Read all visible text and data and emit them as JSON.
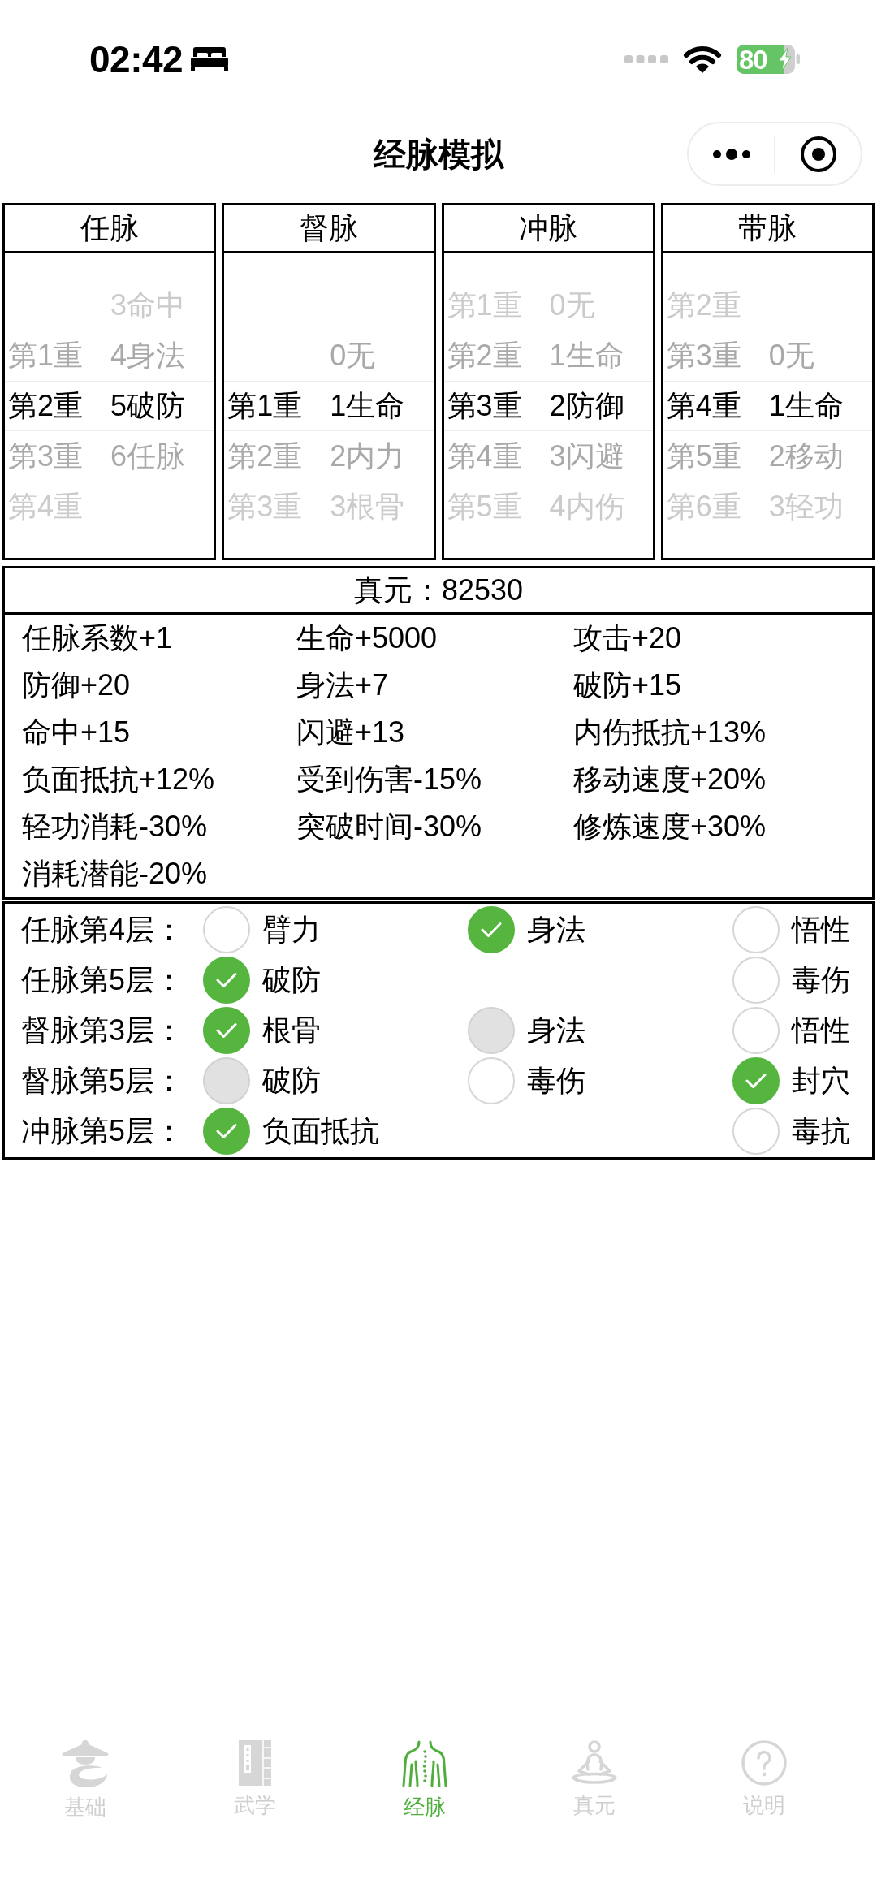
{
  "status_bar": {
    "time": "02:42",
    "battery": "80",
    "charging": true
  },
  "nav_bar": {
    "title": "经脉模拟"
  },
  "meridians": [
    {
      "title": "任脉",
      "levels": [
        {
          "label": "第1重",
          "selected": false
        },
        {
          "label": "第2重",
          "selected": true
        },
        {
          "label": "第3重",
          "selected": false
        },
        {
          "label": "第4重",
          "selected": false
        }
      ],
      "attributes": [
        {
          "label": "3命中",
          "selected": false
        },
        {
          "label": "4身法",
          "selected": false
        },
        {
          "label": "5破防",
          "selected": true
        },
        {
          "label": "6任脉",
          "selected": false
        }
      ]
    },
    {
      "title": "督脉",
      "levels": [
        {
          "label": "第1重",
          "selected": true
        },
        {
          "label": "第2重",
          "selected": false
        },
        {
          "label": "第3重",
          "selected": false
        }
      ],
      "attributes": [
        {
          "label": "0无",
          "selected": false
        },
        {
          "label": "1生命",
          "selected": true
        },
        {
          "label": "2内力",
          "selected": false
        },
        {
          "label": "3根骨",
          "selected": false
        }
      ]
    },
    {
      "title": "冲脉",
      "levels": [
        {
          "label": "第1重",
          "selected": false
        },
        {
          "label": "第2重",
          "selected": false
        },
        {
          "label": "第3重",
          "selected": true
        },
        {
          "label": "第4重",
          "selected": false
        },
        {
          "label": "第5重",
          "selected": false
        }
      ],
      "attributes": [
        {
          "label": "0无",
          "selected": false
        },
        {
          "label": "1生命",
          "selected": false
        },
        {
          "label": "2防御",
          "selected": true
        },
        {
          "label": "3闪避",
          "selected": false
        },
        {
          "label": "4内伤",
          "selected": false
        }
      ]
    },
    {
      "title": "带脉",
      "levels": [
        {
          "label": "第2重",
          "selected": false
        },
        {
          "label": "第3重",
          "selected": false
        },
        {
          "label": "第4重",
          "selected": true
        },
        {
          "label": "第5重",
          "selected": false
        },
        {
          "label": "第6重",
          "selected": false
        }
      ],
      "attributes": [
        {
          "label": "0无",
          "selected": false
        },
        {
          "label": "1生命",
          "selected": true
        },
        {
          "label": "2移动",
          "selected": false
        },
        {
          "label": "3轻功",
          "selected": false
        }
      ]
    }
  ],
  "stats": {
    "total": "真元：82530",
    "bonuses": [
      "任脉系数+1",
      "生命+5000",
      "攻击+20",
      "防御+20",
      "身法+7",
      "破防+15",
      "命中+15",
      "闪避+13",
      "内伤抵抗+13%",
      "负面抵抗+12%",
      "受到伤害-15%",
      "移动速度+20%",
      "轻功消耗-30%",
      "突破时间-30%",
      "修炼速度+30%",
      "消耗潜能-20%"
    ]
  },
  "choices": [
    {
      "label": "任脉第4层：",
      "left": {
        "label": "臂力",
        "checked": false,
        "disabled": false
      },
      "middle": {
        "label": "身法",
        "checked": true,
        "disabled": false
      },
      "right": {
        "label": "悟性",
        "checked": false,
        "disabled": false
      }
    },
    {
      "label": "任脉第5层：",
      "left": {
        "label": "破防",
        "checked": true,
        "disabled": false
      },
      "right": {
        "label": "毒伤",
        "checked": false,
        "disabled": false
      }
    },
    {
      "label": "督脉第3层：",
      "left": {
        "label": "根骨",
        "checked": true,
        "disabled": false
      },
      "middle": {
        "label": "身法",
        "checked": false,
        "disabled": true
      },
      "right": {
        "label": "悟性",
        "checked": false,
        "disabled": false
      }
    },
    {
      "label": "督脉第5层：",
      "left": {
        "label": "破防",
        "checked": false,
        "disabled": true
      },
      "middle": {
        "label": "毒伤",
        "checked": false,
        "disabled": false
      },
      "right": {
        "label": "封穴",
        "checked": true,
        "disabled": false
      }
    },
    {
      "label": "冲脉第5层：",
      "left": {
        "label": "负面抵抗",
        "checked": true,
        "disabled": false
      },
      "right": {
        "label": "毒抗",
        "checked": false,
        "disabled": false
      }
    }
  ],
  "tab_bar": [
    {
      "label": "基础",
      "selected": false
    },
    {
      "label": "武学",
      "selected": false
    },
    {
      "label": "经脉",
      "selected": true
    },
    {
      "label": "真元",
      "selected": false
    },
    {
      "label": "说明",
      "selected": false
    }
  ]
}
